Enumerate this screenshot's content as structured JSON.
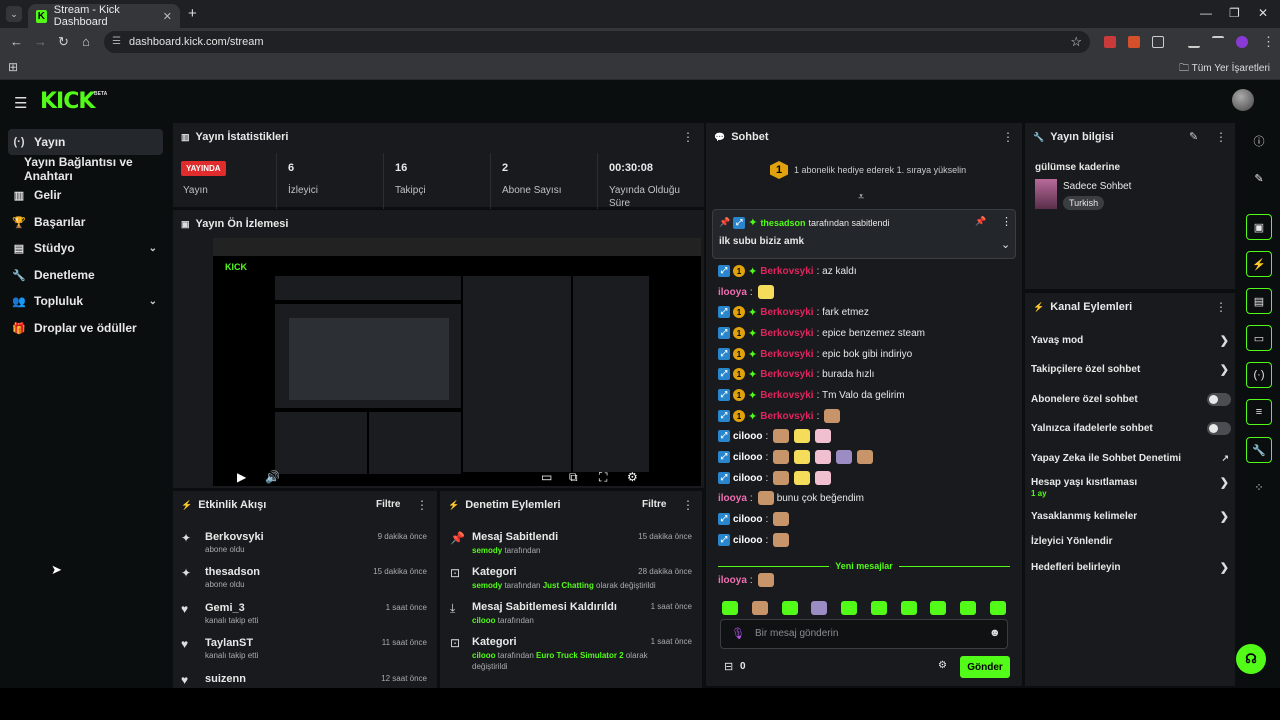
{
  "browser": {
    "tab_title": "Stream - Kick Dashboard",
    "url": "dashboard.kick.com/stream",
    "bookmarks_folder": "Tüm Yer İşaretleri"
  },
  "header": {
    "logo": "KICK",
    "beta": "BETA"
  },
  "sidebar": {
    "items": [
      {
        "label": "Yayın",
        "icon": "broadcast-icon"
      },
      {
        "label": "Yayın Bağlantısı ve Anahtarı"
      },
      {
        "label": "Gelir",
        "icon": "chart-icon"
      },
      {
        "label": "Başarılar",
        "icon": "trophy-icon"
      },
      {
        "label": "Stüdyo",
        "icon": "studio-icon"
      },
      {
        "label": "Denetleme",
        "icon": "wrench-icon"
      },
      {
        "label": "Topluluk",
        "icon": "users-icon"
      },
      {
        "label": "Droplar ve ödüller",
        "icon": "gift-icon"
      }
    ]
  },
  "stats": {
    "title": "Yayın İstatistikleri",
    "live_badge": "YAYINDA",
    "live_label": "Yayın",
    "items": [
      {
        "value": "6",
        "label": "İzleyici"
      },
      {
        "value": "16",
        "label": "Takipçi"
      },
      {
        "value": "2",
        "label": "Abone Sayısı"
      },
      {
        "value": "00:30:08",
        "label": "Yayında Olduğu Süre"
      }
    ]
  },
  "preview": {
    "title": "Yayın Ön İzlemesi"
  },
  "activity": {
    "title": "Etkinlik Akışı",
    "filter": "Filtre",
    "items": [
      {
        "name": "Berkovsyki",
        "sub": "abone oldu",
        "time": "9 dakika önce"
      },
      {
        "name": "thesadson",
        "sub": "abone oldu",
        "time": "15 dakika önce"
      },
      {
        "name": "Gemi_3",
        "sub": "kanalı takip etti",
        "time": "1 saat önce"
      },
      {
        "name": "TaylanST",
        "sub": "kanalı takip etti",
        "time": "11 saat önce"
      },
      {
        "name": "suizenn",
        "sub": "",
        "time": "12 saat önce"
      }
    ]
  },
  "modlog": {
    "title": "Denetim Eylemleri",
    "filter": "Filtre",
    "items": [
      {
        "name": "Mesaj Sabitlendi",
        "actor": "semody",
        "rest": " tarafından",
        "extra": "",
        "extra2": "",
        "time": "15 dakika önce"
      },
      {
        "name": "Kategori",
        "actor": "semody",
        "rest": " tarafından ",
        "extra": "Just Chatting",
        "extra2": " olarak değiştirildi",
        "time": "28 dakika önce"
      },
      {
        "name": "Mesaj Sabitlemesi Kaldırıldı",
        "actor": "cilooo",
        "rest": " tarafından",
        "extra": "",
        "extra2": "",
        "time": "1 saat önce"
      },
      {
        "name": "Kategori",
        "actor": "cilooo",
        "rest": " tarafından ",
        "extra": "Euro Truck Simulator 2",
        "extra2": " olarak değiştirildi",
        "time": "1 saat önce"
      }
    ]
  },
  "chat": {
    "title": "Sohbet",
    "gift_banner": "1 abonelik hediye ederek 1. sıraya yükselin",
    "gift_rank": "1",
    "pinned": {
      "user": "thesadson",
      "by": " tarafından sabitlendi",
      "text": "ilk subu biziz amk"
    },
    "messages": [
      {
        "user": "Berkovsyki",
        "color": "#e0245e",
        "badges": true,
        "text": ": az kaldı"
      },
      {
        "user": "ilooya",
        "color": "#f06fb4",
        "badges": false,
        "text": ":",
        "emotes": 1
      },
      {
        "user": "Berkovsyki",
        "color": "#e0245e",
        "badges": true,
        "text": ": fark etmez"
      },
      {
        "user": "Berkovsyki",
        "color": "#e0245e",
        "badges": true,
        "text": ": epice benzemez steam"
      },
      {
        "user": "Berkovsyki",
        "color": "#e0245e",
        "badges": true,
        "text": ": epic bok gibi indiriyo"
      },
      {
        "user": "Berkovsyki",
        "color": "#e0245e",
        "badges": true,
        "text": ": burada hızlı"
      },
      {
        "user": "Berkovsyki",
        "color": "#e0245e",
        "badges": true,
        "text": ": Tm Valo da gelirim"
      },
      {
        "user": "Berkovsyki",
        "color": "#e0245e",
        "badges": true,
        "text": ":",
        "emotes": 1
      },
      {
        "user": "cilooo",
        "color": "#ffffff",
        "mod": true,
        "text": ":",
        "emotes": 3
      },
      {
        "user": "cilooo",
        "color": "#ffffff",
        "mod": true,
        "text": ":",
        "emotes": 5
      },
      {
        "user": "cilooo",
        "color": "#ffffff",
        "mod": true,
        "text": ":",
        "emotes": 3
      },
      {
        "user": "ilooya",
        "color": "#f06fb4",
        "badges": false,
        "text": ":",
        "emotes": 1,
        "after": " bunu çok beğendim"
      },
      {
        "user": "cilooo",
        "color": "#ffffff",
        "mod": true,
        "text": ":",
        "emotes": 1
      },
      {
        "user": "cilooo",
        "color": "#ffffff",
        "mod": true,
        "text": ":",
        "emotes": 1
      }
    ],
    "new_messages": "Yeni mesajlar",
    "last": {
      "user": "ilooya",
      "text": ":"
    },
    "input_placeholder": "Bir mesaj gönderin",
    "points": "0",
    "send": "Gönder"
  },
  "info": {
    "title": "Yayın bilgisi",
    "stream_title": "gülümse kaderine",
    "category": "Sadece Sohbet",
    "language": "Turkish"
  },
  "actions": {
    "title": "Kanal Eylemleri",
    "items": [
      {
        "label": "Yavaş mod",
        "kind": "chev"
      },
      {
        "label": "Takipçilere özel sohbet",
        "kind": "chev"
      },
      {
        "label": "Abonelere özel sohbet",
        "kind": "toggle"
      },
      {
        "label": "Yalnızca ifadelerle sohbet",
        "kind": "toggle"
      },
      {
        "label": "Yapay Zeka ile Sohbet Denetimi",
        "kind": "ext"
      },
      {
        "label": "Hesap yaşı kısıtlaması",
        "kind": "chev",
        "sub": "1 ay"
      },
      {
        "label": "Yasaklanmış kelimeler",
        "kind": "chev"
      },
      {
        "label": "İzleyici Yönlendir",
        "kind": "none"
      },
      {
        "label": "Hedefleri belirleyin",
        "kind": "chev"
      }
    ]
  },
  "colors": {
    "accent": "#53fc18",
    "live": "#e02c2c",
    "panel": "#181a1d",
    "bg": "#0b0e0f"
  }
}
